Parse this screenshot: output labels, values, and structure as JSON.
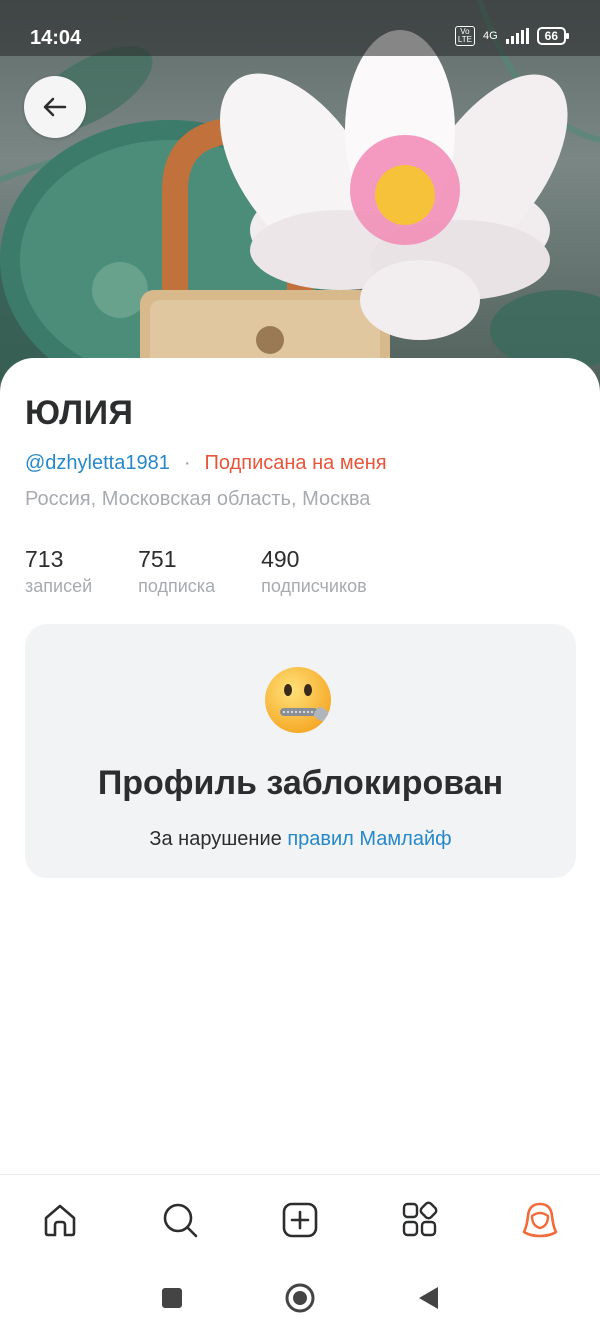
{
  "status_bar": {
    "time": "14:04",
    "network": "4G",
    "volte": "Vo LTE",
    "battery": "66"
  },
  "header": {
    "back_icon": "arrow-left-icon",
    "cover_image": "padlock-and-water-lily-illustration"
  },
  "profile": {
    "name": "ЮЛИЯ",
    "handle": "@dzhyletta1981",
    "separator": "·",
    "follow_status": "Подписана на меня",
    "location": "Россия, Московская область, Москва",
    "stats": [
      {
        "value": "713",
        "label": "записей"
      },
      {
        "value": "751",
        "label": "подписка"
      },
      {
        "value": "490",
        "label": "подписчиков"
      }
    ]
  },
  "blocked_notice": {
    "emoji": "zipper-mouth-face",
    "title": "Профиль заблокирован",
    "reason_prefix": "За нарушение",
    "rules_link": "правил Мамлайф"
  },
  "bottom_nav": {
    "items": [
      "home-icon",
      "search-icon",
      "add-post-icon",
      "services-icon",
      "profile-icon"
    ],
    "active": "profile-icon",
    "accent_color": "#f26b3a"
  },
  "colors": {
    "link": "#2688c9",
    "follow_status": "#e8553a",
    "muted": "#a7abb0",
    "card_bg": "#f2f3f5"
  }
}
